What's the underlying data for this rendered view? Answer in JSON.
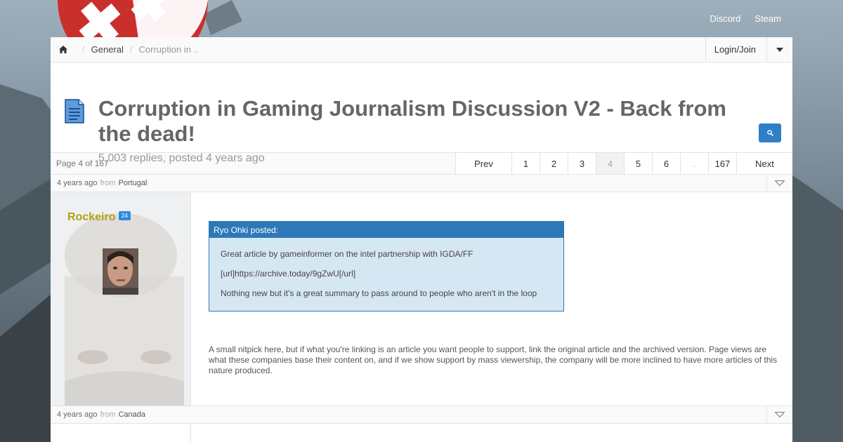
{
  "topnav": {
    "discord": "Discord",
    "steam": "Steam"
  },
  "breadcrumb": {
    "general": "General",
    "current": "Corruption in .."
  },
  "header": {
    "login": "Login/Join"
  },
  "thread": {
    "title": "Corruption in Gaming Journalism Discussion V2 - Back from the dead!",
    "subtitle": "5,003 replies, posted 4 years ago"
  },
  "pager": {
    "info": "Page 4 of 167",
    "prev": "Prev",
    "pages": [
      "1",
      "2",
      "3",
      "4",
      "5",
      "6",
      "..",
      "167"
    ],
    "current": "4",
    "next": "Next"
  },
  "posts": [
    {
      "time": "4 years ago",
      "from_label": "from",
      "country": "Portugal",
      "username": "Rockeiro",
      "badge": "24",
      "quote": {
        "header": "Ryo Ohki posted:",
        "lines": [
          "Great article by gameinformer on the intel partnership with IGDA/FF",
          "[url]https://archive.today/9gZwU[/url]",
          "Nothing new but it's a great summary to pass around to people who aren't in the loop"
        ]
      },
      "body": "A small nitpick here, but if what you're linking is an article you want people to support, link the original article and the archived version. Page views are what these companies base their content on, and if we show support by mass viewership, the company will be more inclined to have more articles of this nature produced."
    },
    {
      "time": "4 years ago",
      "from_label": "from",
      "country": "Canada"
    }
  ],
  "colors": {
    "accent": "#2f7fc5",
    "username": "#b1a113",
    "quote_bg": "#d6e7f4"
  },
  "icons": [
    "home-icon",
    "caret-down-icon",
    "document-icon",
    "search-icon",
    "collapse-triangle-icon"
  ]
}
